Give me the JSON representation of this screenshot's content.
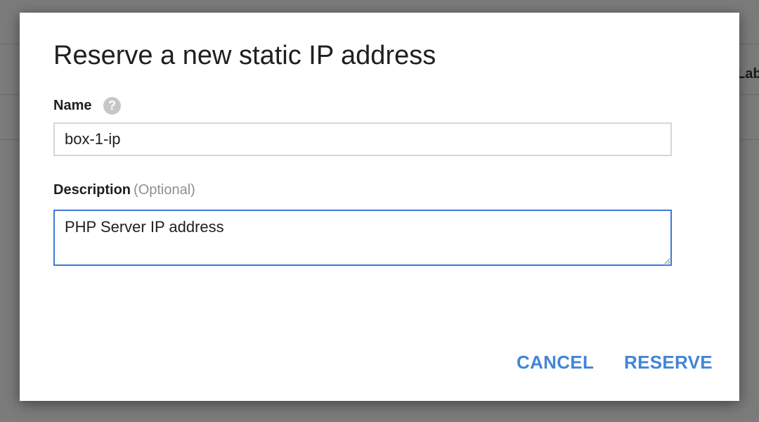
{
  "background": {
    "peek_text": "Label"
  },
  "dialog": {
    "title": "Reserve a new static IP address",
    "name_field": {
      "label": "Name",
      "help_icon": "help-circle-icon",
      "value": "box-1-ip"
    },
    "description_field": {
      "label": "Description",
      "optional_hint": "(Optional)",
      "value": "PHP Server IP address"
    },
    "buttons": {
      "cancel": "CANCEL",
      "reserve": "RESERVE"
    },
    "colors": {
      "accent": "#4285d8",
      "focus_border": "#3f7ad6",
      "overlay": "#7b7b7b"
    }
  }
}
